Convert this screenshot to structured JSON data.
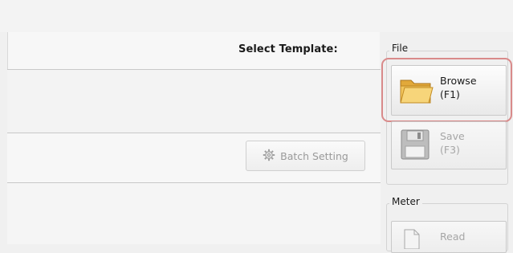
{
  "header": {
    "select_template_label": "Select Template:"
  },
  "main": {
    "batch_setting_label": "Batch Setting"
  },
  "file_group": {
    "label": "File",
    "browse": {
      "line1": "Browse",
      "line2": "(F1)",
      "icon": "folder-icon"
    },
    "save": {
      "line1": "Save",
      "line2": "(F3)",
      "icon": "floppy-disk-icon"
    }
  },
  "meter_group": {
    "label": "Meter",
    "read": {
      "line1": "Read",
      "icon": "document-icon"
    }
  },
  "colors": {
    "highlight": "#d98a8a",
    "disabled_text": "#a6a6a6"
  }
}
